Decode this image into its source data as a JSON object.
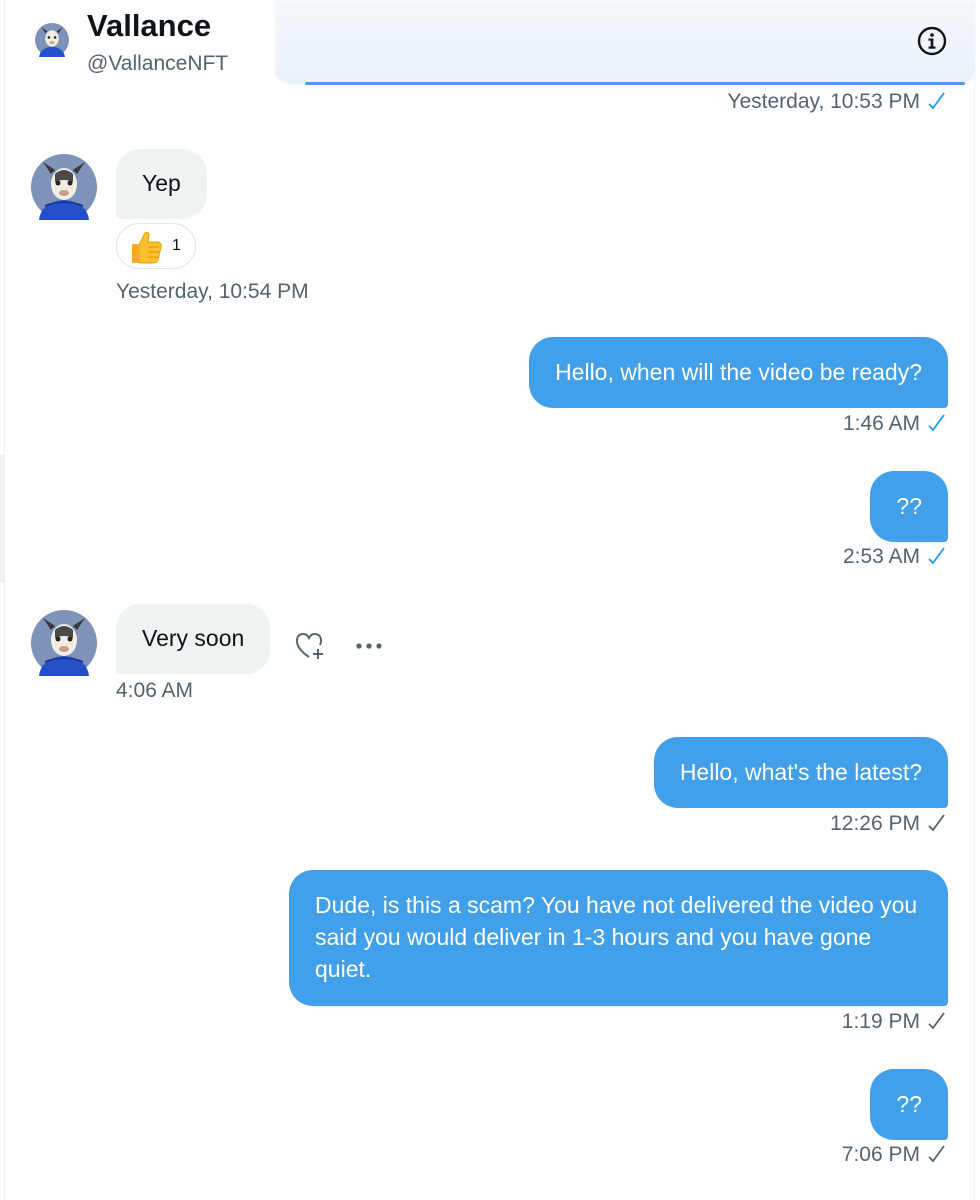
{
  "header": {
    "name": "Vallance",
    "handle": "@VallanceNFT"
  },
  "messages": [
    {
      "direction": "out",
      "text": "",
      "time": "Yesterday, 10:53 PM",
      "read": true
    },
    {
      "direction": "in",
      "text": "Yep",
      "time": "Yesterday, 10:54 PM",
      "reaction": {
        "emoji": "thumbs-up",
        "count": "1"
      }
    },
    {
      "direction": "out",
      "text": "Hello, when will the video be ready?",
      "time": "1:46 AM",
      "read": true
    },
    {
      "direction": "out",
      "text": "??",
      "time": "2:53 AM",
      "read": true
    },
    {
      "direction": "in",
      "text": "Very soon",
      "time": "4:06 AM"
    },
    {
      "direction": "out",
      "text": "Hello, what's the latest?",
      "time": "12:26 PM",
      "read": false
    },
    {
      "direction": "out",
      "text": "Dude, is this a scam? You have not delivered the video you said you would deliver in 1-3 hours and you have gone quiet.",
      "time": "1:19 PM",
      "read": false
    },
    {
      "direction": "out",
      "text": "??",
      "time": "7:06 PM",
      "read": false
    }
  ],
  "colors": {
    "outgoing_bubble": "#429fe9",
    "incoming_bubble": "#eff3f4",
    "read_check": "#1d9bf0",
    "sent_check": "#536471",
    "timestamp": "#536471"
  },
  "icons": {
    "info": "info-icon",
    "react": "heart-plus-icon",
    "more": "more-icon",
    "reaction": "thumbs-up-emoji"
  }
}
